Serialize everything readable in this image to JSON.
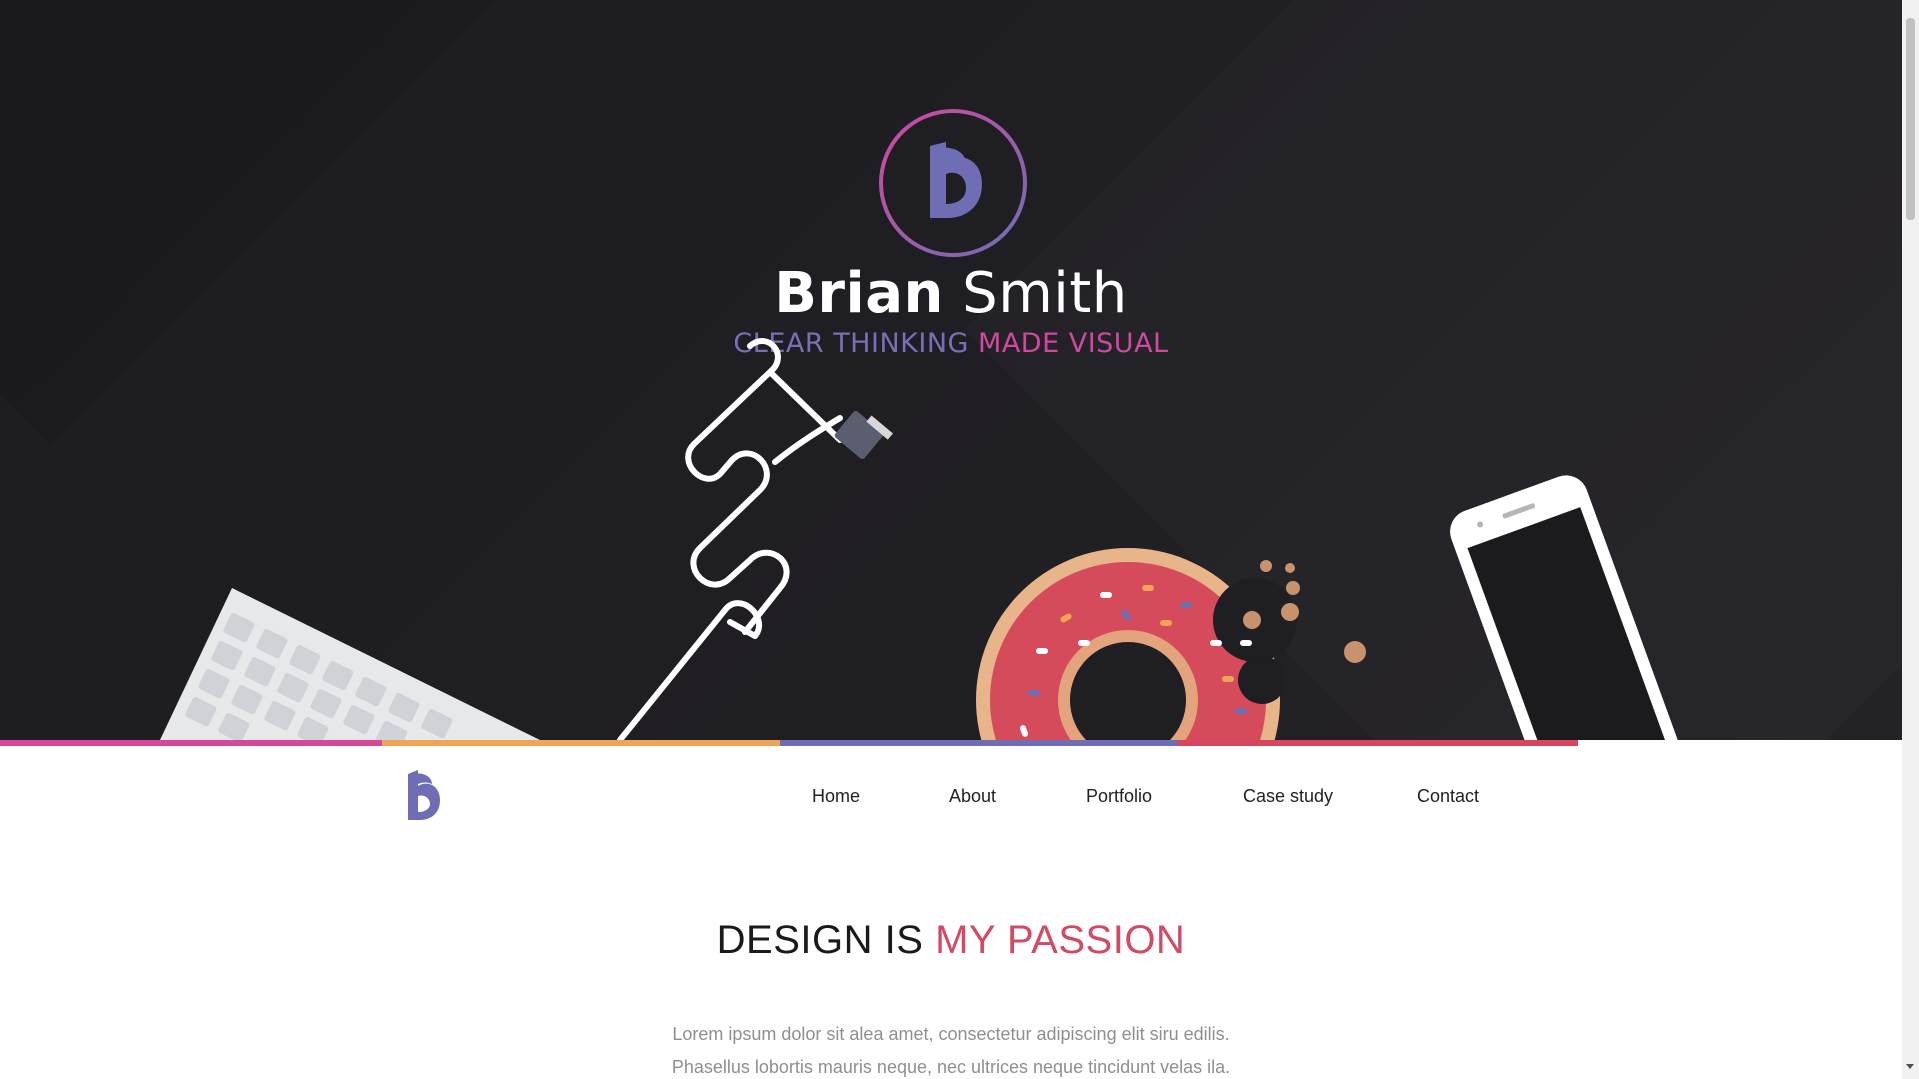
{
  "hero": {
    "logo_letter": "B",
    "name_first": "Brian",
    "name_last": "Smith",
    "tagline_part1": "CLEAR THINKING",
    "tagline_part2": "MADE VISUAL",
    "illustrations": [
      "keyboard-illustration",
      "cable-illustration",
      "donut-illustration",
      "smartphone-illustration"
    ]
  },
  "strip_colors": [
    "#d7489a",
    "#f0a553",
    "#6f6db3",
    "#d9455f"
  ],
  "nav": {
    "logo_letter": "B",
    "items": [
      "Home",
      "About",
      "Portfolio",
      "Case study",
      "Contact"
    ]
  },
  "content": {
    "headline_part1": "DESIGN IS",
    "headline_part2": "MY PASSION",
    "paragraph_line1": "Lorem ipsum dolor sit alea amet, consectetur adipiscing elit siru edilis.",
    "paragraph_line2": "Phasellus lobortis mauris neque, nec ultrices neque tincidunt velas ila."
  },
  "colors": {
    "hero_bg": "#1f1e23",
    "logo_purple": "#6f6db3",
    "accent_pink": "#d2489e",
    "accent_red": "#d24a63",
    "text_gray": "#8f8f8f"
  }
}
